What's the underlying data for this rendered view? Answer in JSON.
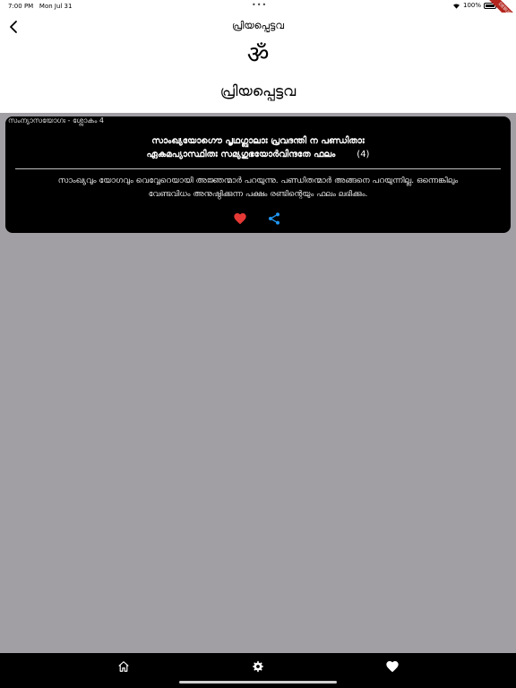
{
  "status_bar": {
    "time": "7:00 PM",
    "date": "Mon Jul 31",
    "battery": "100%"
  },
  "debug_banner": "DEBUG",
  "header": {
    "nav_title": "പ്രിയപ്പെട്ടവ",
    "om": "ॐ",
    "page_heading": "പ്രിയപ്പെട്ടവ"
  },
  "verse_card": {
    "meta": "സംന്യാസയോഗഃ - ശ്ലോകം 4",
    "sloka_line1": "സാംഖ്യയോഗൌ പൃഥഗ്ബാലാഃ പ്രവദന്തി ന പണ്ഡിതാഃ",
    "sloka_line2": "ഏകമപ്യാസ്ഥിതഃ സമ്യഗുഭയോർവിന്ദതേ ഫലം",
    "sloka_number": "(4)",
    "meaning_line1": "സാംഖ്യവും യോഗവും വെവ്വേറെയായി അജ്ഞന്മാർ പറയുന്നു. പണ്ഡിതന്മാർ അങ്ങനെ പറയുന്നില്ല. ഒന്നെങ്കിലും",
    "meaning_line2": "വേണ്ടവിധം അനുഷ്ഠിക്കുന്ന പക്ഷം രണ്ടിന്റെയും ഫലം ലഭിക്കും."
  },
  "icons": {
    "back": "chevron-left-icon",
    "favorite": "heart-icon",
    "share": "share-icon",
    "home": "home-icon",
    "settings": "gear-icon",
    "favorites": "heart-icon"
  },
  "colors": {
    "favorite": "#e53935",
    "share": "#2196f3",
    "background": "#a19fa4"
  }
}
